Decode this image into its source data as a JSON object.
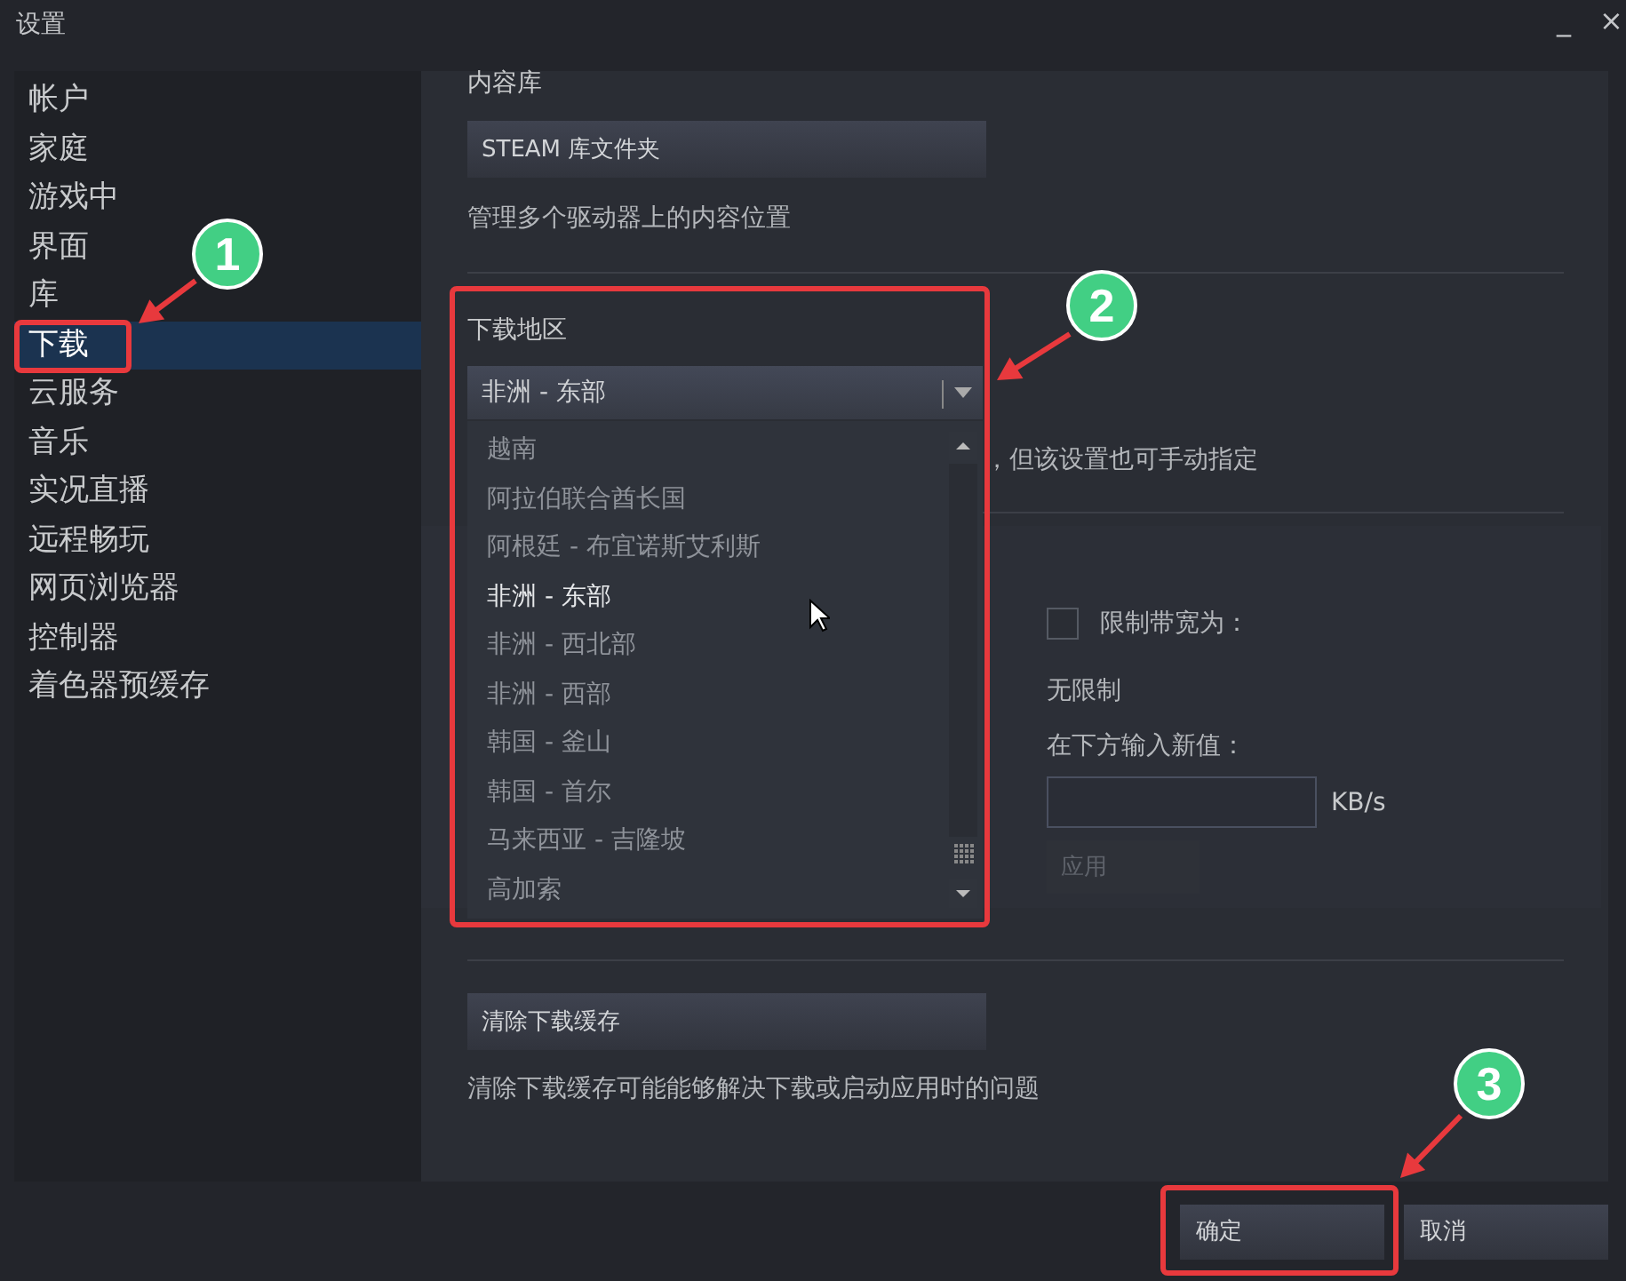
{
  "window": {
    "title": "设置",
    "controls": [
      "_",
      "×"
    ]
  },
  "sidebar": {
    "items": [
      {
        "label": "帐户",
        "selected": false
      },
      {
        "label": "家庭",
        "selected": false
      },
      {
        "label": "游戏中",
        "selected": false
      },
      {
        "label": "界面",
        "selected": false
      },
      {
        "label": "库",
        "selected": false
      },
      {
        "label": "下载",
        "selected": true
      },
      {
        "label": "云服务",
        "selected": false
      },
      {
        "label": "音乐",
        "selected": false
      },
      {
        "label": "实况直播",
        "selected": false
      },
      {
        "label": "远程畅玩",
        "selected": false
      },
      {
        "label": "网页浏览器",
        "selected": false
      },
      {
        "label": "控制器",
        "selected": false
      },
      {
        "label": "着色器预缓存",
        "selected": false
      }
    ]
  },
  "content": {
    "library": {
      "heading": "内容库",
      "button": "STEAM 库文件夹",
      "description": "管理多个驱动器上的内容位置"
    },
    "download_region": {
      "heading": "下载地区",
      "value": "非洲 - 东部",
      "expanded": true,
      "note": "，但该设置也可手动指定",
      "options": [
        {
          "label": "越南",
          "selected": false
        },
        {
          "label": "阿拉伯联合酋长国",
          "selected": false
        },
        {
          "label": "阿根廷 - 布宜诺斯艾利斯",
          "selected": false
        },
        {
          "label": "非洲 - 东部",
          "selected": true
        },
        {
          "label": "非洲 - 西北部",
          "selected": false
        },
        {
          "label": "非洲 - 西部",
          "selected": false
        },
        {
          "label": "韩国 - 釜山",
          "selected": false
        },
        {
          "label": "韩国 - 首尔",
          "selected": false
        },
        {
          "label": "马来西亚 - 吉隆坡",
          "selected": false
        },
        {
          "label": "高加索",
          "selected": false
        }
      ]
    },
    "bandwidth": {
      "checked": false,
      "label": "限制带宽为：",
      "current": "无限制",
      "prompt": "在下方输入新值：",
      "unit": "KB/s",
      "apply": {
        "label": "应用",
        "disabled": true
      }
    },
    "cache": {
      "button": "清除下载缓存",
      "description": "清除下载缓存可能能够解决下载或启动应用时的问题"
    }
  },
  "buttons": [
    {
      "label": "确定"
    },
    {
      "label": "取消"
    }
  ],
  "annotations": [
    {
      "number": "1"
    },
    {
      "number": "2"
    },
    {
      "number": "3"
    }
  ]
}
